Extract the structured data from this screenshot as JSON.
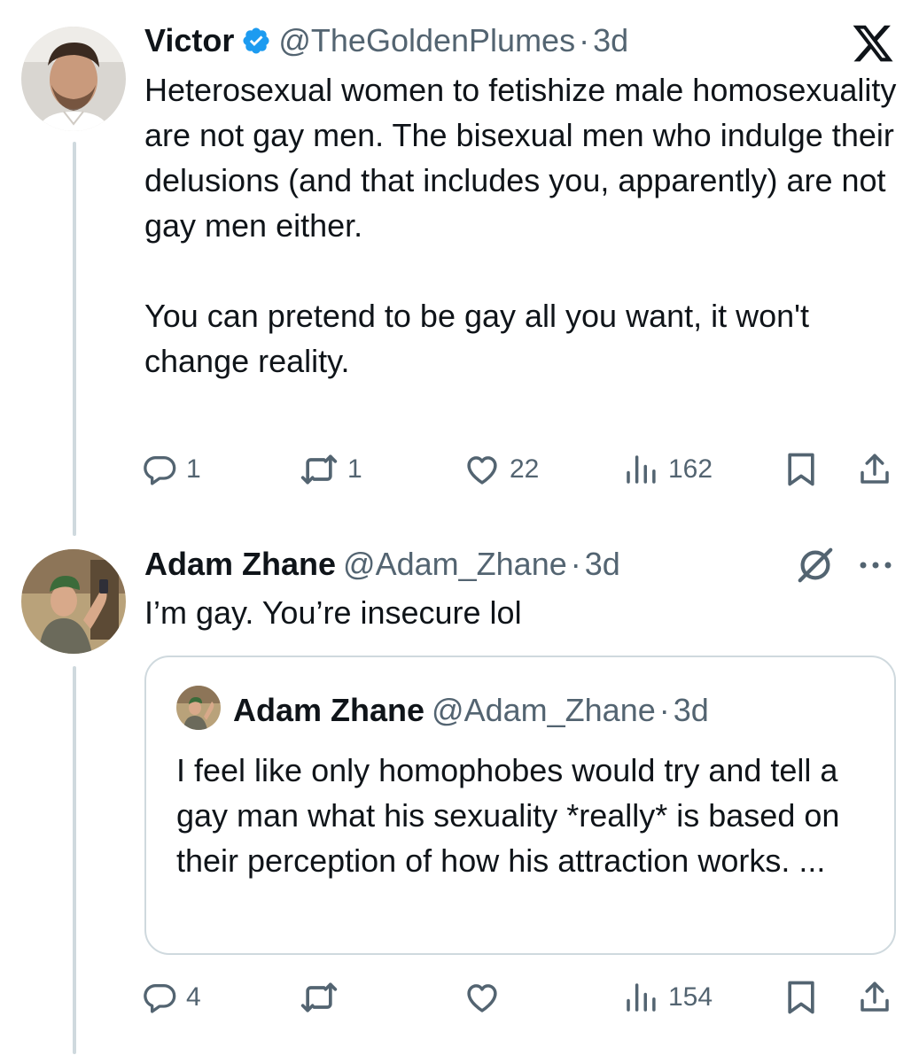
{
  "tweet1": {
    "name": "Victor",
    "handle": "@TheGoldenPlumes",
    "dot": "·",
    "time": "3d",
    "paragraph1": "Heterosexual women to fetishize male homosexuality are not gay men. The bisexual men who indulge their delusions (and that includes you, apparently) are not gay men either.",
    "paragraph2": "You can pretend to be gay all you want, it won't change reality.",
    "replies": "1",
    "retweets": "1",
    "likes": "22",
    "views": "162",
    "verified_color": "#1d9bf0"
  },
  "tweet2": {
    "name": "Adam Zhane",
    "handle": "@Adam_Zhane",
    "dot": "·",
    "time": "3d",
    "text": "I’m gay. You’re insecure lol",
    "replies": "4",
    "retweets": "",
    "likes": "",
    "views": "154",
    "quote": {
      "name": "Adam Zhane",
      "handle": "@Adam_Zhane",
      "dot": "·",
      "time": "3d",
      "text": "I feel like only homophobes would try and tell a gay man what his sexuality *really* is based on their perception of how his attraction works. ..."
    }
  },
  "icons": {
    "brand": "x-logo-icon",
    "grok": "grok-icon",
    "more": "more-options-icon",
    "reply": "reply-icon",
    "retweet": "retweet-icon",
    "like": "like-icon",
    "views": "views-icon",
    "bookmark": "bookmark-icon",
    "share": "share-icon"
  },
  "colors": {
    "text": "#0f1419",
    "secondary": "#536471",
    "border": "#cfd9de",
    "verified": "#1d9bf0"
  }
}
